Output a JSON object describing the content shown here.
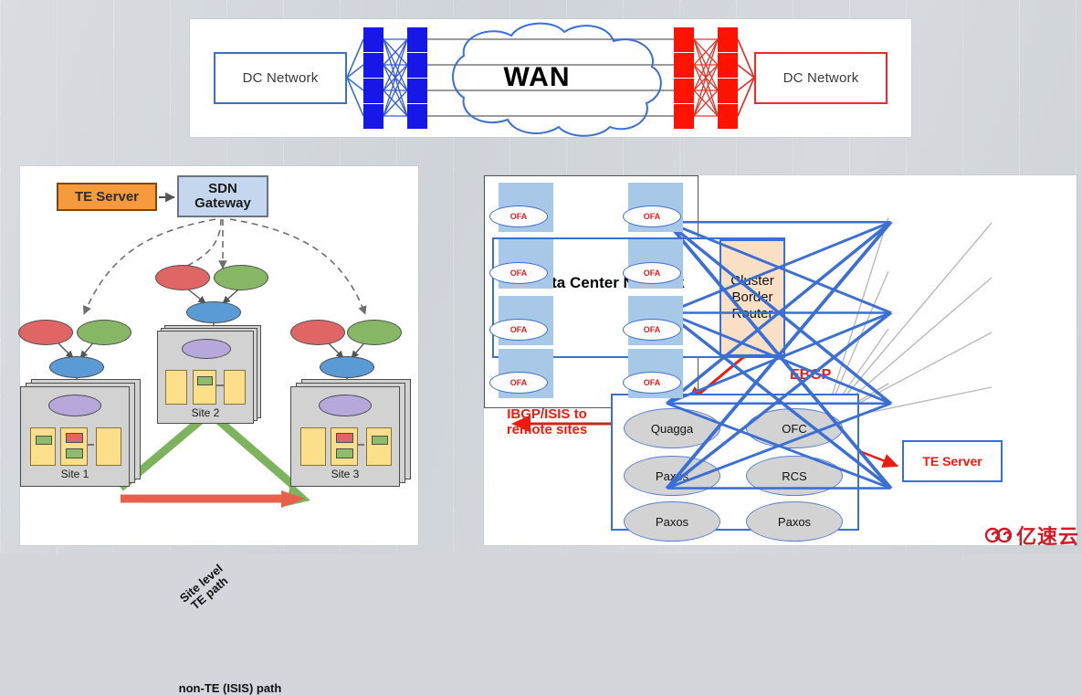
{
  "background": {
    "base_color": "#d3d7dc"
  },
  "top_diagram": {
    "name": "wan-interconnect-diagram",
    "left_dc_label": "DC Network",
    "right_dc_label": "DC Network",
    "wan_label": "WAN",
    "left_dc_border_color": "#3b72c4",
    "right_dc_border_color": "#ee2a24",
    "left_router_color": "#1717e8",
    "right_router_color": "#fd1400",
    "left_router_count": 8,
    "right_router_count": 8,
    "wan_link_count": 4
  },
  "bottom_left_diagram": {
    "name": "sdn-te-sites-diagram",
    "te_server_label": "TE Server",
    "sdn_gateway_label": "SDN\nGateway",
    "te_server_fill": "#f79a3c",
    "sdn_gateway_fill": "#c4d7ef",
    "sites": [
      {
        "name": "Site 1"
      },
      {
        "name": "Site 2"
      },
      {
        "name": "Site 3"
      }
    ],
    "te_path_label": "Site level\nTE path",
    "non_te_path_label": "non-TE (ISIS) path",
    "te_path_color": "#7cb35c",
    "non_te_path_color": "#e8604c"
  },
  "bottom_right_diagram": {
    "name": "cluster-controller-diagram",
    "dc_network_label": "Data Center\nNetwork",
    "cluster_border_router_label": "Cluster\nBorder\nRouter",
    "cluster_border_router_fill": "#fbe0c6",
    "ebgp_label": "EBGP",
    "ibgp_label": "IBGP/ISIS to\nremote sites",
    "te_server_label": "TE Server",
    "accent_color": "#ee1b11",
    "controller_nodes": [
      {
        "label": "Quagga"
      },
      {
        "label": "OFC"
      },
      {
        "label": "Paxos"
      },
      {
        "label": "RCS"
      },
      {
        "label": "Paxos"
      },
      {
        "label": "Paxos"
      }
    ],
    "ofa_panel": {
      "switch_count": 8,
      "agent_label": "OFA",
      "switch_fill": "#a8c8e8",
      "agent_text_color": "#e02020"
    }
  },
  "watermark": {
    "text": "亿速云",
    "color": "#cf1b24",
    "logo": "cloud-spiral-logo"
  }
}
